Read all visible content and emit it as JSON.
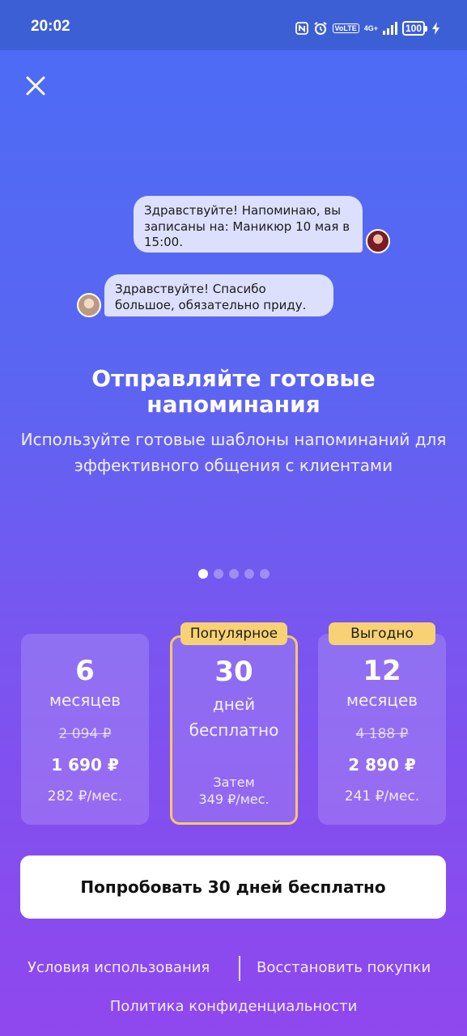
{
  "status_bar": {
    "time": "20:02",
    "volte_label": "VoLTE",
    "network_label": "4G+",
    "battery_level": "100"
  },
  "chat": {
    "incoming": "Здравствуйте! Напоминаю, вы записаны на: Маникюр 10 мая в 15:00.",
    "reply": "Здравствуйте! Спасибо большое, обязательно приду."
  },
  "headline": "Отправляйте готовые напоминания",
  "subtext": "Используйте готовые шаблоны напоминаний для эффективного общения с клиентами",
  "pagination": {
    "total": 5,
    "active_index": 0
  },
  "plans": [
    {
      "number": "6",
      "unit": "месяцев",
      "old_price": "2 094 ₽",
      "price": "1 690 ₽",
      "per_month": "282 ₽/мес."
    },
    {
      "badge": "Популярное",
      "number": "30",
      "unit": "дней бесплатно",
      "then_label": "Затем",
      "per_month": "349 ₽/мес.",
      "selected": true
    },
    {
      "badge": "Выгодно",
      "number": "12",
      "unit": "месяцев",
      "old_price": "4 188 ₽",
      "price": "2 890 ₽",
      "per_month": "241 ₽/мес."
    }
  ],
  "cta_label": "Попробовать 30 дней бесплатно",
  "footer": {
    "terms": "Условия использования",
    "restore": "Восстановить покупки",
    "privacy": "Политика конфиденциальности"
  },
  "colors": {
    "badge": "#f7d173",
    "selected_border": "#f4c86a",
    "bubble": "#dde0fc"
  },
  "icons": [
    "nfc-icon",
    "alarm-icon",
    "signal-icon",
    "charging-icon",
    "close-icon"
  ]
}
